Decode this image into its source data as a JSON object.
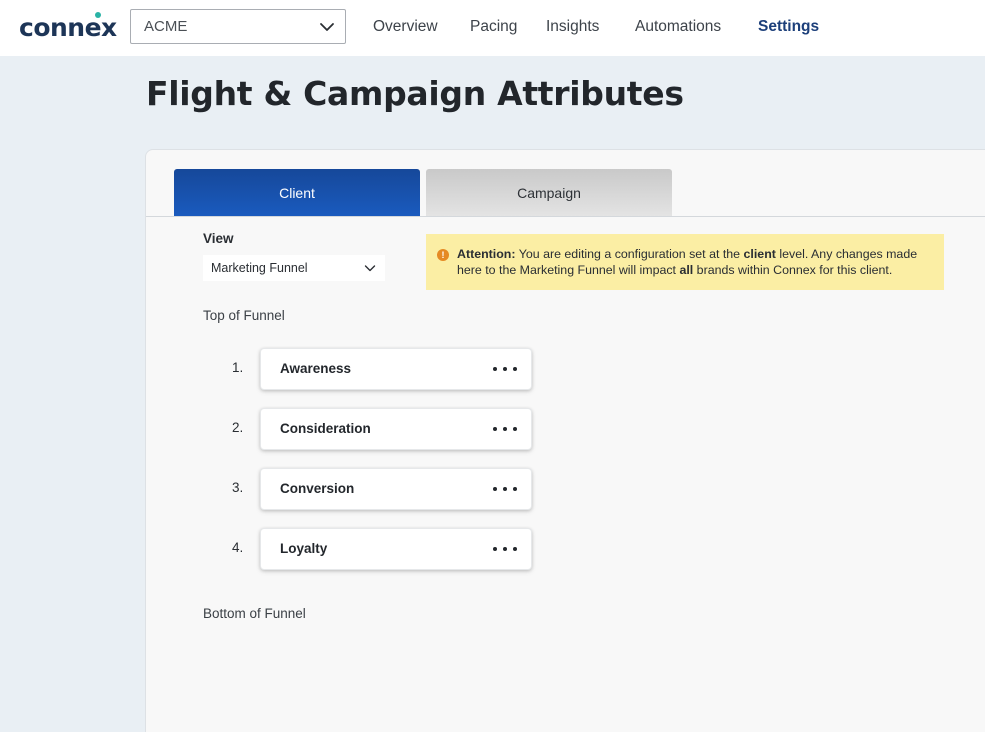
{
  "brand": {
    "logo_text": "connex",
    "accent": "#2ab3a6"
  },
  "client_selector": {
    "value": "ACME"
  },
  "nav": {
    "items": [
      {
        "label": "Overview"
      },
      {
        "label": "Pacing"
      },
      {
        "label": "Insights"
      },
      {
        "label": "Automations"
      },
      {
        "label": "Settings",
        "active": true
      }
    ]
  },
  "page": {
    "title": "Flight & Campaign Attributes"
  },
  "tabs": [
    {
      "label": "Client",
      "active": true
    },
    {
      "label": "Campaign",
      "active": false
    }
  ],
  "view": {
    "label": "View",
    "selected": "Marketing Funnel"
  },
  "alert": {
    "icon": "warning-icon",
    "prefix": "Attention:",
    "text_1": " You are editing a configuration set at the ",
    "bold_1": "client",
    "text_2": " level. Any changes made here to the Marketing Funnel will impact ",
    "bold_2": "all",
    "text_3": " brands within Connex for this client."
  },
  "funnel": {
    "top_label": "Top of Funnel",
    "bottom_label": "Bottom of Funnel",
    "stages": [
      {
        "num": "1.",
        "label": "Awareness"
      },
      {
        "num": "2.",
        "label": "Consideration"
      },
      {
        "num": "3.",
        "label": "Conversion"
      },
      {
        "num": "4.",
        "label": "Loyalty"
      }
    ]
  },
  "colors": {
    "active_tab": "#1a5bbf",
    "active_nav": "#1c3f7a",
    "alert_bg": "#fbeea4",
    "alert_icon": "#e58a24"
  }
}
